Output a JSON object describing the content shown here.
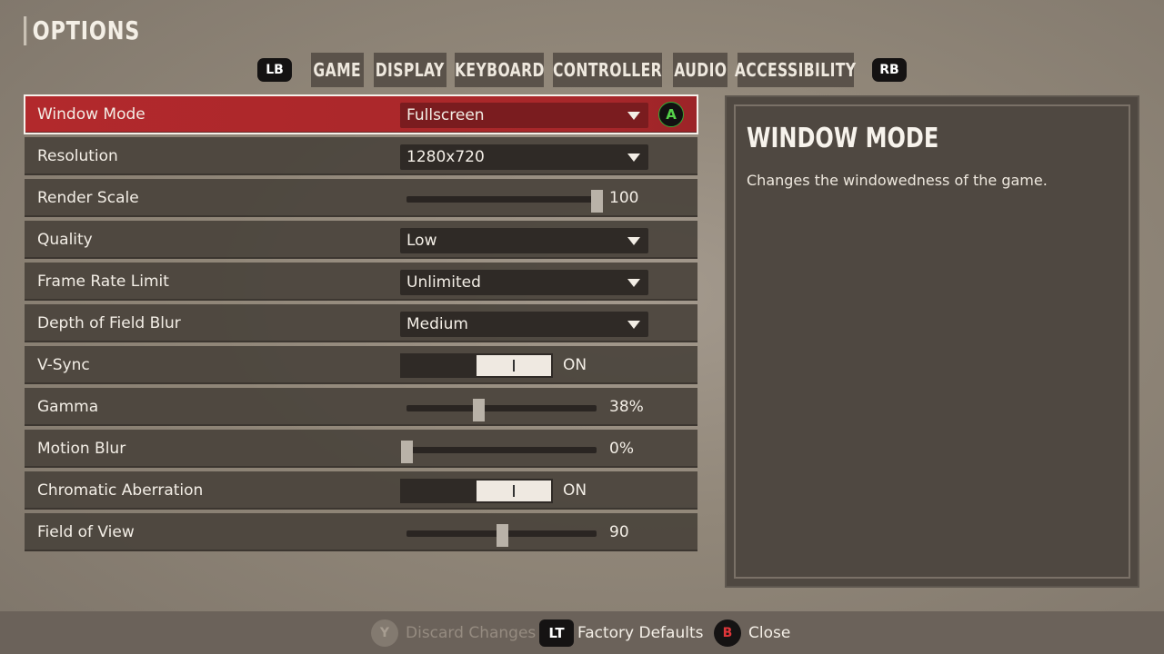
{
  "header": {
    "title": "OPTIONS"
  },
  "tabs": {
    "left_bumper": "LB",
    "right_bumper": "RB",
    "items": [
      {
        "label": "GAME",
        "active": false
      },
      {
        "label": "DISPLAY",
        "active": true
      },
      {
        "label": "KEYBOARD",
        "active": false
      },
      {
        "label": "CONTROLLER",
        "active": false
      },
      {
        "label": "AUDIO",
        "active": false
      },
      {
        "label": "ACCESSIBILITY",
        "active": false
      }
    ]
  },
  "settings": [
    {
      "label": "Window Mode",
      "type": "dropdown",
      "value": "Fullscreen",
      "selected": true,
      "confirm_button": "A"
    },
    {
      "label": "Resolution",
      "type": "dropdown",
      "value": "1280x720"
    },
    {
      "label": "Render Scale",
      "type": "slider",
      "value_text": "100",
      "level": 1.0
    },
    {
      "label": "Quality",
      "type": "dropdown",
      "value": "Low"
    },
    {
      "label": "Frame Rate Limit",
      "type": "dropdown",
      "value": "Unlimited"
    },
    {
      "label": "Depth of Field Blur",
      "type": "dropdown",
      "value": "Medium"
    },
    {
      "label": "V-Sync",
      "type": "toggle",
      "value": "ON",
      "on": true
    },
    {
      "label": "Gamma",
      "type": "slider",
      "value_text": "38%",
      "level": 0.38
    },
    {
      "label": "Motion Blur",
      "type": "slider",
      "value_text": "0%",
      "level": 0.0
    },
    {
      "label": "Chromatic Aberration",
      "type": "toggle",
      "value": "ON",
      "on": true
    },
    {
      "label": "Field of View",
      "type": "slider",
      "value_text": "90",
      "level": 0.5
    }
  ],
  "info": {
    "title": "WINDOW MODE",
    "description": "Changes the windowedness of the game."
  },
  "footer": {
    "discard": {
      "button": "Y",
      "label": "Discard Changes",
      "enabled": false
    },
    "defaults": {
      "button": "LT",
      "label": "Factory Defaults"
    },
    "close": {
      "button": "B",
      "label": "Close"
    }
  },
  "colors": {
    "accent": "#b2292c",
    "panel": "#4a433c",
    "a_button": "#55d24a",
    "b_button": "#e0363a"
  }
}
